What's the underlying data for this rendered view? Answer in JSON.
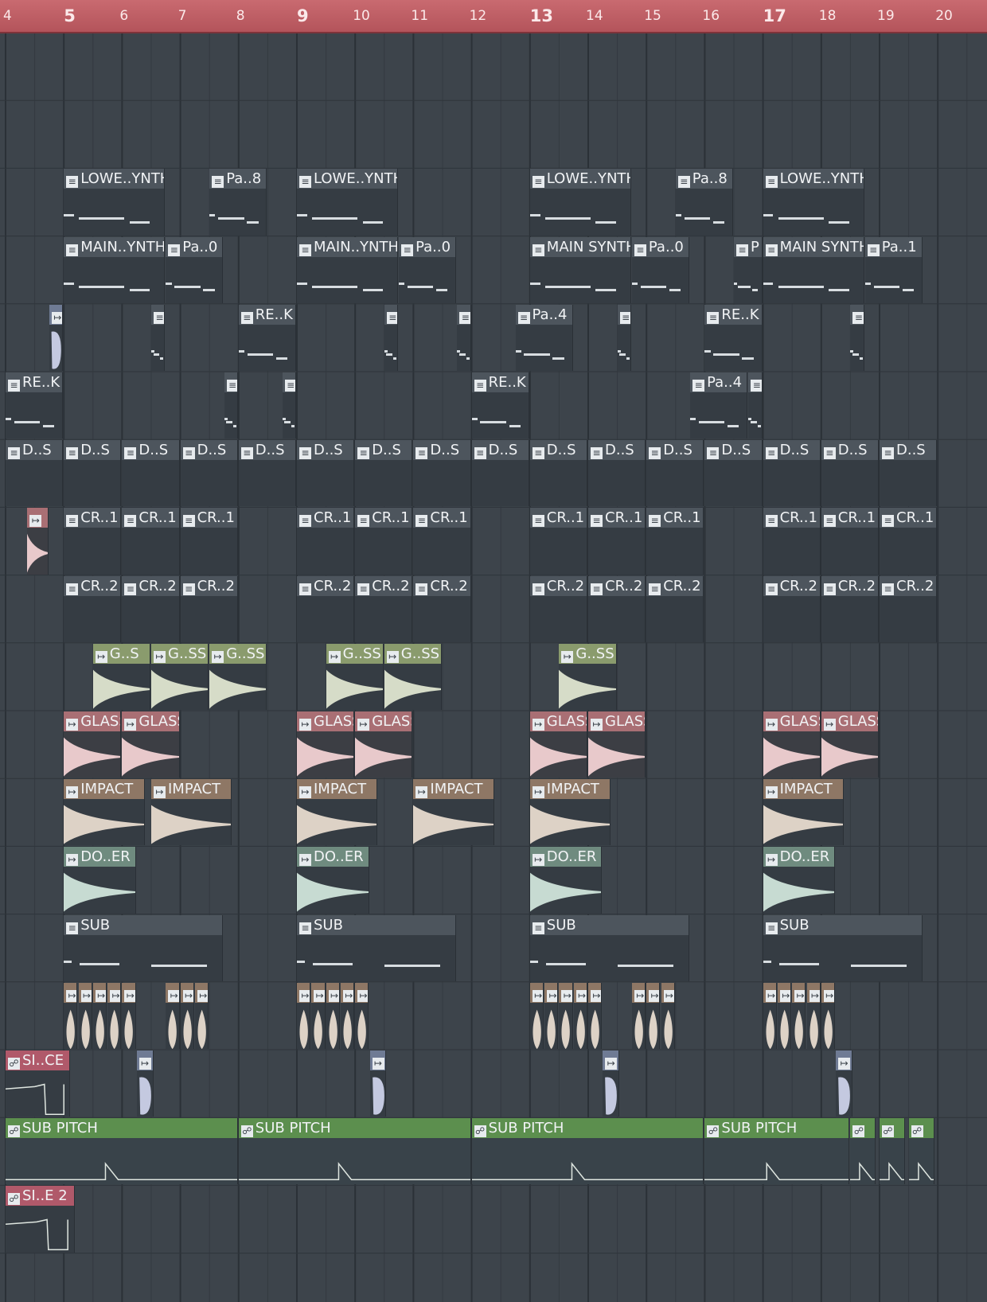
{
  "ruler": {
    "bars": [
      {
        "label": "4",
        "major": false
      },
      {
        "label": "5",
        "major": true
      },
      {
        "label": "6",
        "major": false
      },
      {
        "label": "7",
        "major": false
      },
      {
        "label": "8",
        "major": false
      },
      {
        "label": "9",
        "major": true
      },
      {
        "label": "10",
        "major": false
      },
      {
        "label": "11",
        "major": false
      },
      {
        "label": "12",
        "major": false
      },
      {
        "label": "13",
        "major": true
      },
      {
        "label": "14",
        "major": false
      },
      {
        "label": "15",
        "major": false
      },
      {
        "label": "16",
        "major": false
      },
      {
        "label": "17",
        "major": true
      },
      {
        "label": "18",
        "major": false
      },
      {
        "label": "19",
        "major": false
      },
      {
        "label": "20",
        "major": false
      }
    ]
  },
  "colors": {
    "background": "#3d444b",
    "ruler": "#b9575e",
    "pattern_header": "#4d555d",
    "audio_green": "#8a9b6d",
    "audio_pink": "#a96f74",
    "audio_tan": "#8e7765",
    "audio_mint": "#6f8b7f",
    "audio_steel": "#6f7b94",
    "automation_pink": "#b0596a",
    "automation_green": "#5c8f4e",
    "wave_green": "#d6dcc8",
    "wave_pink": "#e8c9cb",
    "wave_tan": "#ddd2c6",
    "wave_mint": "#c7dbd2",
    "wave_steel": "#c4c9e0"
  },
  "icons": {
    "pattern": "piano-roll-icon",
    "audio": "audio-clip-icon",
    "automation": "automation-clip-icon"
  },
  "clip_rows": [
    {
      "row": "track-3",
      "clips": [
        {
          "label": "LOWE..YNTH",
          "kind": "pattern",
          "bar": 5,
          "len": 1.75
        },
        {
          "label": "Pa..8",
          "kind": "pattern",
          "bar": 7.5,
          "len": 1
        },
        {
          "label": "LOWE..YNTH",
          "kind": "pattern",
          "bar": 9,
          "len": 1.75
        },
        {
          "label": "LOWE..YNTH",
          "kind": "pattern",
          "bar": 13,
          "len": 1.75
        },
        {
          "label": "Pa..8",
          "kind": "pattern",
          "bar": 15.5,
          "len": 1
        },
        {
          "label": "LOWE..YNTH",
          "kind": "pattern",
          "bar": 17,
          "len": 1.75
        }
      ]
    },
    {
      "row": "track-4",
      "clips": [
        {
          "label": "MAIN..YNTH",
          "kind": "pattern",
          "bar": 5,
          "len": 1.75
        },
        {
          "label": "Pa..0",
          "kind": "pattern",
          "bar": 6.75,
          "len": 1
        },
        {
          "label": "MAIN..YNTH",
          "kind": "pattern",
          "bar": 9,
          "len": 1.75
        },
        {
          "label": "Pa..0",
          "kind": "pattern",
          "bar": 10.75,
          "len": 1
        },
        {
          "label": "MAIN SYNTH",
          "kind": "pattern",
          "bar": 13,
          "len": 1.75
        },
        {
          "label": "Pa..0",
          "kind": "pattern",
          "bar": 14.75,
          "len": 1
        },
        {
          "label": "P",
          "kind": "pattern",
          "bar": 16.5,
          "len": 0.5
        },
        {
          "label": "MAIN SYNTH",
          "kind": "pattern",
          "bar": 17,
          "len": 1.75
        },
        {
          "label": "Pa..1",
          "kind": "pattern",
          "bar": 18.75,
          "len": 1
        }
      ]
    },
    {
      "row": "track-5",
      "clips": [
        {
          "label": "",
          "kind": "audio-steel",
          "bar": 4.75,
          "len": 0.25
        },
        {
          "label": "",
          "kind": "pattern",
          "bar": 6.5,
          "len": 0.25
        },
        {
          "label": "RE..K",
          "kind": "pattern",
          "bar": 8,
          "len": 1
        },
        {
          "label": "",
          "kind": "pattern",
          "bar": 10.5,
          "len": 0.25
        },
        {
          "label": "",
          "kind": "pattern",
          "bar": 11.75,
          "len": 0.25
        },
        {
          "label": "Pa..4",
          "kind": "pattern",
          "bar": 12.75,
          "len": 1
        },
        {
          "label": "",
          "kind": "pattern",
          "bar": 14.5,
          "len": 0.25
        },
        {
          "label": "RE..K",
          "kind": "pattern",
          "bar": 16,
          "len": 1
        },
        {
          "label": "",
          "kind": "pattern",
          "bar": 18.5,
          "len": 0.25
        }
      ]
    },
    {
      "row": "track-6",
      "clips": [
        {
          "label": "RE..K",
          "kind": "pattern",
          "bar": 4,
          "len": 1
        },
        {
          "label": "",
          "kind": "pattern",
          "bar": 7.75,
          "len": 0.25
        },
        {
          "label": "",
          "kind": "pattern",
          "bar": 8.75,
          "len": 0.25
        },
        {
          "label": "RE..K",
          "kind": "pattern",
          "bar": 12,
          "len": 1
        },
        {
          "label": "Pa..4",
          "kind": "pattern",
          "bar": 15.75,
          "len": 1
        },
        {
          "label": "",
          "kind": "pattern",
          "bar": 16.75,
          "len": 0.25
        }
      ]
    },
    {
      "row": "track-7",
      "clips": [
        {
          "label": "D..S",
          "kind": "pattern",
          "bar": 4,
          "len": 1
        },
        {
          "label": "D..S",
          "kind": "pattern",
          "bar": 5,
          "len": 1
        },
        {
          "label": "D..S",
          "kind": "pattern",
          "bar": 6,
          "len": 1
        },
        {
          "label": "D..S",
          "kind": "pattern",
          "bar": 7,
          "len": 1
        },
        {
          "label": "D..S",
          "kind": "pattern",
          "bar": 8,
          "len": 1
        },
        {
          "label": "D..S",
          "kind": "pattern",
          "bar": 9,
          "len": 1
        },
        {
          "label": "D..S",
          "kind": "pattern",
          "bar": 10,
          "len": 1
        },
        {
          "label": "D..S",
          "kind": "pattern",
          "bar": 11,
          "len": 1
        },
        {
          "label": "D..S",
          "kind": "pattern",
          "bar": 12,
          "len": 1
        },
        {
          "label": "D..S",
          "kind": "pattern",
          "bar": 13,
          "len": 1
        },
        {
          "label": "D..S",
          "kind": "pattern",
          "bar": 14,
          "len": 1
        },
        {
          "label": "D..S",
          "kind": "pattern",
          "bar": 15,
          "len": 1
        },
        {
          "label": "D..S",
          "kind": "pattern",
          "bar": 16,
          "len": 1
        },
        {
          "label": "D..S",
          "kind": "pattern",
          "bar": 17,
          "len": 1
        },
        {
          "label": "D..S",
          "kind": "pattern",
          "bar": 18,
          "len": 1
        },
        {
          "label": "D..S",
          "kind": "pattern",
          "bar": 19,
          "len": 1
        }
      ]
    },
    {
      "row": "track-8",
      "clips": [
        {
          "label": "",
          "kind": "audio-pink",
          "bar": 4.375,
          "len": 0.375
        },
        {
          "label": "CR..1",
          "kind": "pattern",
          "bar": 5,
          "len": 1
        },
        {
          "label": "CR..1",
          "kind": "pattern",
          "bar": 6,
          "len": 1
        },
        {
          "label": "CR..1",
          "kind": "pattern",
          "bar": 7,
          "len": 1
        },
        {
          "label": "CR..1",
          "kind": "pattern",
          "bar": 9,
          "len": 1
        },
        {
          "label": "CR..1",
          "kind": "pattern",
          "bar": 10,
          "len": 1
        },
        {
          "label": "CR..1",
          "kind": "pattern",
          "bar": 11,
          "len": 1
        },
        {
          "label": "CR..1",
          "kind": "pattern",
          "bar": 13,
          "len": 1
        },
        {
          "label": "CR..1",
          "kind": "pattern",
          "bar": 14,
          "len": 1
        },
        {
          "label": "CR..1",
          "kind": "pattern",
          "bar": 15,
          "len": 1
        },
        {
          "label": "CR..1",
          "kind": "pattern",
          "bar": 17,
          "len": 1
        },
        {
          "label": "CR..1",
          "kind": "pattern",
          "bar": 18,
          "len": 1
        },
        {
          "label": "CR..1",
          "kind": "pattern",
          "bar": 19,
          "len": 1
        }
      ]
    },
    {
      "row": "track-9",
      "clips": [
        {
          "label": "CR..2",
          "kind": "pattern",
          "bar": 5,
          "len": 1
        },
        {
          "label": "CR..2",
          "kind": "pattern",
          "bar": 6,
          "len": 1
        },
        {
          "label": "CR..2",
          "kind": "pattern",
          "bar": 7,
          "len": 1
        },
        {
          "label": "CR..2",
          "kind": "pattern",
          "bar": 9,
          "len": 1
        },
        {
          "label": "CR..2",
          "kind": "pattern",
          "bar": 10,
          "len": 1
        },
        {
          "label": "CR..2",
          "kind": "pattern",
          "bar": 11,
          "len": 1
        },
        {
          "label": "CR..2",
          "kind": "pattern",
          "bar": 13,
          "len": 1
        },
        {
          "label": "CR..2",
          "kind": "pattern",
          "bar": 14,
          "len": 1
        },
        {
          "label": "CR..2",
          "kind": "pattern",
          "bar": 15,
          "len": 1
        },
        {
          "label": "CR..2",
          "kind": "pattern",
          "bar": 17,
          "len": 1
        },
        {
          "label": "CR..2",
          "kind": "pattern",
          "bar": 18,
          "len": 1
        },
        {
          "label": "CR..2",
          "kind": "pattern",
          "bar": 19,
          "len": 1
        }
      ]
    },
    {
      "row": "track-10",
      "clips": [
        {
          "label": "G..S",
          "kind": "audio-green",
          "bar": 5.5,
          "len": 1
        },
        {
          "label": "G..SS",
          "kind": "audio-green",
          "bar": 6.5,
          "len": 1
        },
        {
          "label": "G..SS",
          "kind": "audio-green",
          "bar": 7.5,
          "len": 1
        },
        {
          "label": "G..SS",
          "kind": "audio-green",
          "bar": 9.5,
          "len": 1
        },
        {
          "label": "G..SS",
          "kind": "audio-green",
          "bar": 10.5,
          "len": 1
        },
        {
          "label": "G..SS",
          "kind": "audio-green",
          "bar": 13.5,
          "len": 1
        }
      ]
    },
    {
      "row": "track-11",
      "clips": [
        {
          "label": "GLASS",
          "kind": "audio-pink",
          "bar": 5,
          "len": 1
        },
        {
          "label": "GLASS",
          "kind": "audio-pink",
          "bar": 6,
          "len": 1
        },
        {
          "label": "GLASS",
          "kind": "audio-pink",
          "bar": 9,
          "len": 1
        },
        {
          "label": "GLASS",
          "kind": "audio-pink",
          "bar": 10,
          "len": 1
        },
        {
          "label": "GLASS",
          "kind": "audio-pink",
          "bar": 13,
          "len": 1
        },
        {
          "label": "GLASS",
          "kind": "audio-pink",
          "bar": 14,
          "len": 1
        },
        {
          "label": "GLASS",
          "kind": "audio-pink",
          "bar": 17,
          "len": 1
        },
        {
          "label": "GLASS",
          "kind": "audio-pink",
          "bar": 18,
          "len": 1
        }
      ]
    },
    {
      "row": "track-12",
      "clips": [
        {
          "label": "IMPACT",
          "kind": "audio-tan",
          "bar": 5,
          "len": 1.4
        },
        {
          "label": "IMPACT",
          "kind": "audio-tan",
          "bar": 6.5,
          "len": 1.4
        },
        {
          "label": "IMPACT",
          "kind": "audio-tan",
          "bar": 9,
          "len": 1.4
        },
        {
          "label": "IMPACT",
          "kind": "audio-tan",
          "bar": 11,
          "len": 1.4
        },
        {
          "label": "IMPACT",
          "kind": "audio-tan",
          "bar": 13,
          "len": 1.4
        },
        {
          "label": "IMPACT",
          "kind": "audio-tan",
          "bar": 17,
          "len": 1.4
        }
      ]
    },
    {
      "row": "track-13",
      "clips": [
        {
          "label": "DO..ER",
          "kind": "audio-mint",
          "bar": 5,
          "len": 1.25
        },
        {
          "label": "DO..ER",
          "kind": "audio-mint",
          "bar": 9,
          "len": 1.25
        },
        {
          "label": "DO..ER",
          "kind": "audio-mint",
          "bar": 13,
          "len": 1.25
        },
        {
          "label": "DO..ER",
          "kind": "audio-mint",
          "bar": 17,
          "len": 1.25
        }
      ]
    },
    {
      "row": "track-14",
      "clips": [
        {
          "label": "SUB",
          "kind": "pattern",
          "bar": 5,
          "len": 2.75
        },
        {
          "label": "SUB",
          "kind": "pattern",
          "bar": 9,
          "len": 2.75
        },
        {
          "label": "SUB",
          "kind": "pattern",
          "bar": 13,
          "len": 2.75
        },
        {
          "label": "SUB",
          "kind": "pattern",
          "bar": 17,
          "len": 2.75
        }
      ]
    },
    {
      "row": "track-15",
      "clips": [
        {
          "label": "",
          "kind": "audio-tan",
          "bar": 5,
          "len": 0.25
        },
        {
          "label": "",
          "kind": "audio-tan",
          "bar": 5.25,
          "len": 0.25
        },
        {
          "label": "",
          "kind": "audio-tan",
          "bar": 5.5,
          "len": 0.25
        },
        {
          "label": "",
          "kind": "audio-tan",
          "bar": 5.75,
          "len": 0.25
        },
        {
          "label": "",
          "kind": "audio-tan",
          "bar": 6,
          "len": 0.25
        },
        {
          "label": "",
          "kind": "audio-tan",
          "bar": 6.75,
          "len": 0.25
        },
        {
          "label": "",
          "kind": "audio-tan",
          "bar": 7,
          "len": 0.25
        },
        {
          "label": "",
          "kind": "audio-tan",
          "bar": 7.25,
          "len": 0.25
        },
        {
          "label": "",
          "kind": "audio-tan",
          "bar": 9,
          "len": 0.25
        },
        {
          "label": "",
          "kind": "audio-tan",
          "bar": 9.25,
          "len": 0.25
        },
        {
          "label": "",
          "kind": "audio-tan",
          "bar": 9.5,
          "len": 0.25
        },
        {
          "label": "",
          "kind": "audio-tan",
          "bar": 9.75,
          "len": 0.25
        },
        {
          "label": "",
          "kind": "audio-tan",
          "bar": 10,
          "len": 0.25
        },
        {
          "label": "",
          "kind": "audio-tan",
          "bar": 13,
          "len": 0.25
        },
        {
          "label": "",
          "kind": "audio-tan",
          "bar": 13.25,
          "len": 0.25
        },
        {
          "label": "",
          "kind": "audio-tan",
          "bar": 13.5,
          "len": 0.25
        },
        {
          "label": "",
          "kind": "audio-tan",
          "bar": 13.75,
          "len": 0.25
        },
        {
          "label": "",
          "kind": "audio-tan",
          "bar": 14,
          "len": 0.25
        },
        {
          "label": "",
          "kind": "audio-tan",
          "bar": 14.75,
          "len": 0.25
        },
        {
          "label": "",
          "kind": "audio-tan",
          "bar": 15,
          "len": 0.25
        },
        {
          "label": "",
          "kind": "audio-tan",
          "bar": 15.25,
          "len": 0.25
        },
        {
          "label": "",
          "kind": "audio-tan",
          "bar": 17,
          "len": 0.25
        },
        {
          "label": "",
          "kind": "audio-tan",
          "bar": 17.25,
          "len": 0.25
        },
        {
          "label": "",
          "kind": "audio-tan",
          "bar": 17.5,
          "len": 0.25
        },
        {
          "label": "",
          "kind": "audio-tan",
          "bar": 17.75,
          "len": 0.25
        },
        {
          "label": "",
          "kind": "audio-tan",
          "bar": 18,
          "len": 0.25
        }
      ]
    },
    {
      "row": "track-16",
      "clips": [
        {
          "label": "SI..CE",
          "kind": "auto-pink",
          "bar": 4,
          "len": 1.125
        },
        {
          "label": "",
          "kind": "audio-steel",
          "bar": 6.25,
          "len": 0.3
        },
        {
          "label": "",
          "kind": "audio-steel",
          "bar": 10.25,
          "len": 0.3
        },
        {
          "label": "",
          "kind": "audio-steel",
          "bar": 14.25,
          "len": 0.3
        },
        {
          "label": "",
          "kind": "audio-steel",
          "bar": 18.25,
          "len": 0.3
        }
      ]
    },
    {
      "row": "track-17",
      "clips": [
        {
          "label": "SUB PITCH",
          "kind": "auto-green",
          "bar": 4,
          "len": 4
        },
        {
          "label": "SUB PITCH",
          "kind": "auto-green",
          "bar": 8,
          "len": 4
        },
        {
          "label": "SUB PITCH",
          "kind": "auto-green",
          "bar": 12,
          "len": 4
        },
        {
          "label": "SUB PITCH",
          "kind": "auto-green",
          "bar": 16,
          "len": 2.5
        },
        {
          "label": "",
          "kind": "auto-green",
          "bar": 18.5,
          "len": 0.45
        },
        {
          "label": "",
          "kind": "auto-green",
          "bar": 19,
          "len": 0.45
        },
        {
          "label": "",
          "kind": "auto-green",
          "bar": 19.5,
          "len": 0.45
        }
      ]
    },
    {
      "row": "track-18",
      "clips": [
        {
          "label": "SI..E 2",
          "kind": "auto-pink",
          "bar": 4,
          "len": 1.2
        }
      ]
    }
  ]
}
